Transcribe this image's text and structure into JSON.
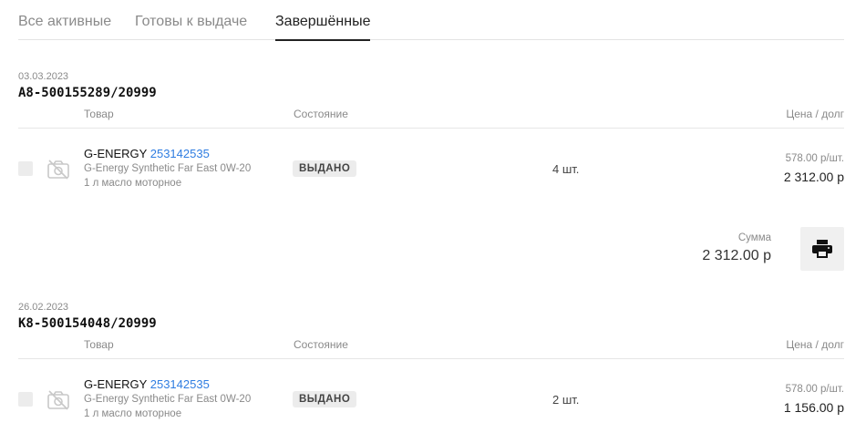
{
  "tabs": [
    {
      "label": "Все активные"
    },
    {
      "label": "Готовы к выдаче"
    },
    {
      "label": "Завершённые"
    }
  ],
  "active_tab": "Завершённые",
  "orders": [
    {
      "date": "03.03.2023",
      "number": "A8-500155289/20999",
      "columns": {
        "goods": "Товар",
        "state": "Состояние",
        "price": "Цена / долг"
      },
      "items": [
        {
          "brand": "G-ENERGY",
          "article": "253142535",
          "name": "G-Energy Synthetic Far East 0W-20",
          "volume": "1 л масло моторное",
          "status": "ВЫДАНО",
          "qty": "4 шт.",
          "unit_price": "578.00 р/шт.",
          "total": "2 312.00 р"
        }
      ],
      "sum_label": "Сумма",
      "sum_value": "2 312.00 р"
    },
    {
      "date": "26.02.2023",
      "number": "K8-500154048/20999",
      "columns": {
        "goods": "Товар",
        "state": "Состояние",
        "price": "Цена / долг"
      },
      "items": [
        {
          "brand": "G-ENERGY",
          "article": "253142535",
          "name": "G-Energy Synthetic Far East 0W-20",
          "volume": "1 л масло моторное",
          "status": "ВЫДАНО",
          "qty": "2 шт.",
          "unit_price": "578.00 р/шт.",
          "total": "1 156.00 р"
        }
      ]
    }
  ],
  "icons": {
    "no_photo": "no-photo-icon",
    "print": "printer-icon"
  },
  "colors": {
    "link": "#2f7de1",
    "muted": "#8a8a8a",
    "badge_bg": "#ececec"
  }
}
